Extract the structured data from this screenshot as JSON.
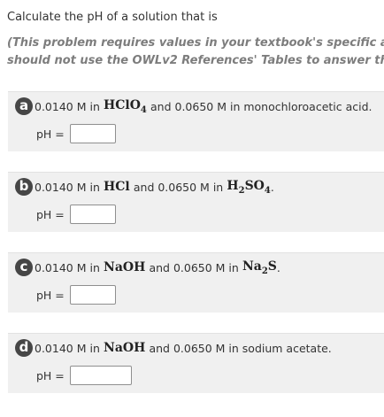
{
  "intro": {
    "line": "Calculate the pH of a solution that is",
    "note_line1": "(This problem requires values in your textbook's specific a",
    "note_line2": "should not use the OWLv2 References' Tables to answer th"
  },
  "parts": [
    {
      "letter": "a",
      "pre": "0.0140 M in",
      "chem1_main": "HClO",
      "chem1_sub": "4",
      "mid": "and 0.0650 M in monochloroacetic acid.",
      "chem2_main": "",
      "chem2_sub": "",
      "tail": "",
      "ph_label": "pH =",
      "ph_value": ""
    },
    {
      "letter": "b",
      "pre": "0.0140 M in",
      "chem1_main": "HCl",
      "chem1_sub": "",
      "mid": "and 0.0650 M in",
      "chem2_main": "H",
      "chem2_sub": "2",
      "chem2_main2": "SO",
      "chem2_sub2": "4",
      "tail": ".",
      "ph_label": "pH =",
      "ph_value": ""
    },
    {
      "letter": "c",
      "pre": "0.0140 M in",
      "chem1_main": "NaOH",
      "chem1_sub": "",
      "mid": "and 0.0650 M in",
      "chem2_main": "Na",
      "chem2_sub": "2",
      "chem2_main2": "S",
      "chem2_sub2": "",
      "tail": ".",
      "ph_label": "pH =",
      "ph_value": ""
    },
    {
      "letter": "d",
      "pre": "0.0140 M in",
      "chem1_main": "NaOH",
      "chem1_sub": "",
      "mid": "and 0.0650 M in sodium acetate.",
      "chem2_main": "",
      "chem2_sub": "",
      "tail": "",
      "ph_label": "pH =",
      "ph_value": ""
    }
  ],
  "colors": {
    "badge": "#464646",
    "panel": "#f0f0f0",
    "note": "#7d7d7d"
  }
}
